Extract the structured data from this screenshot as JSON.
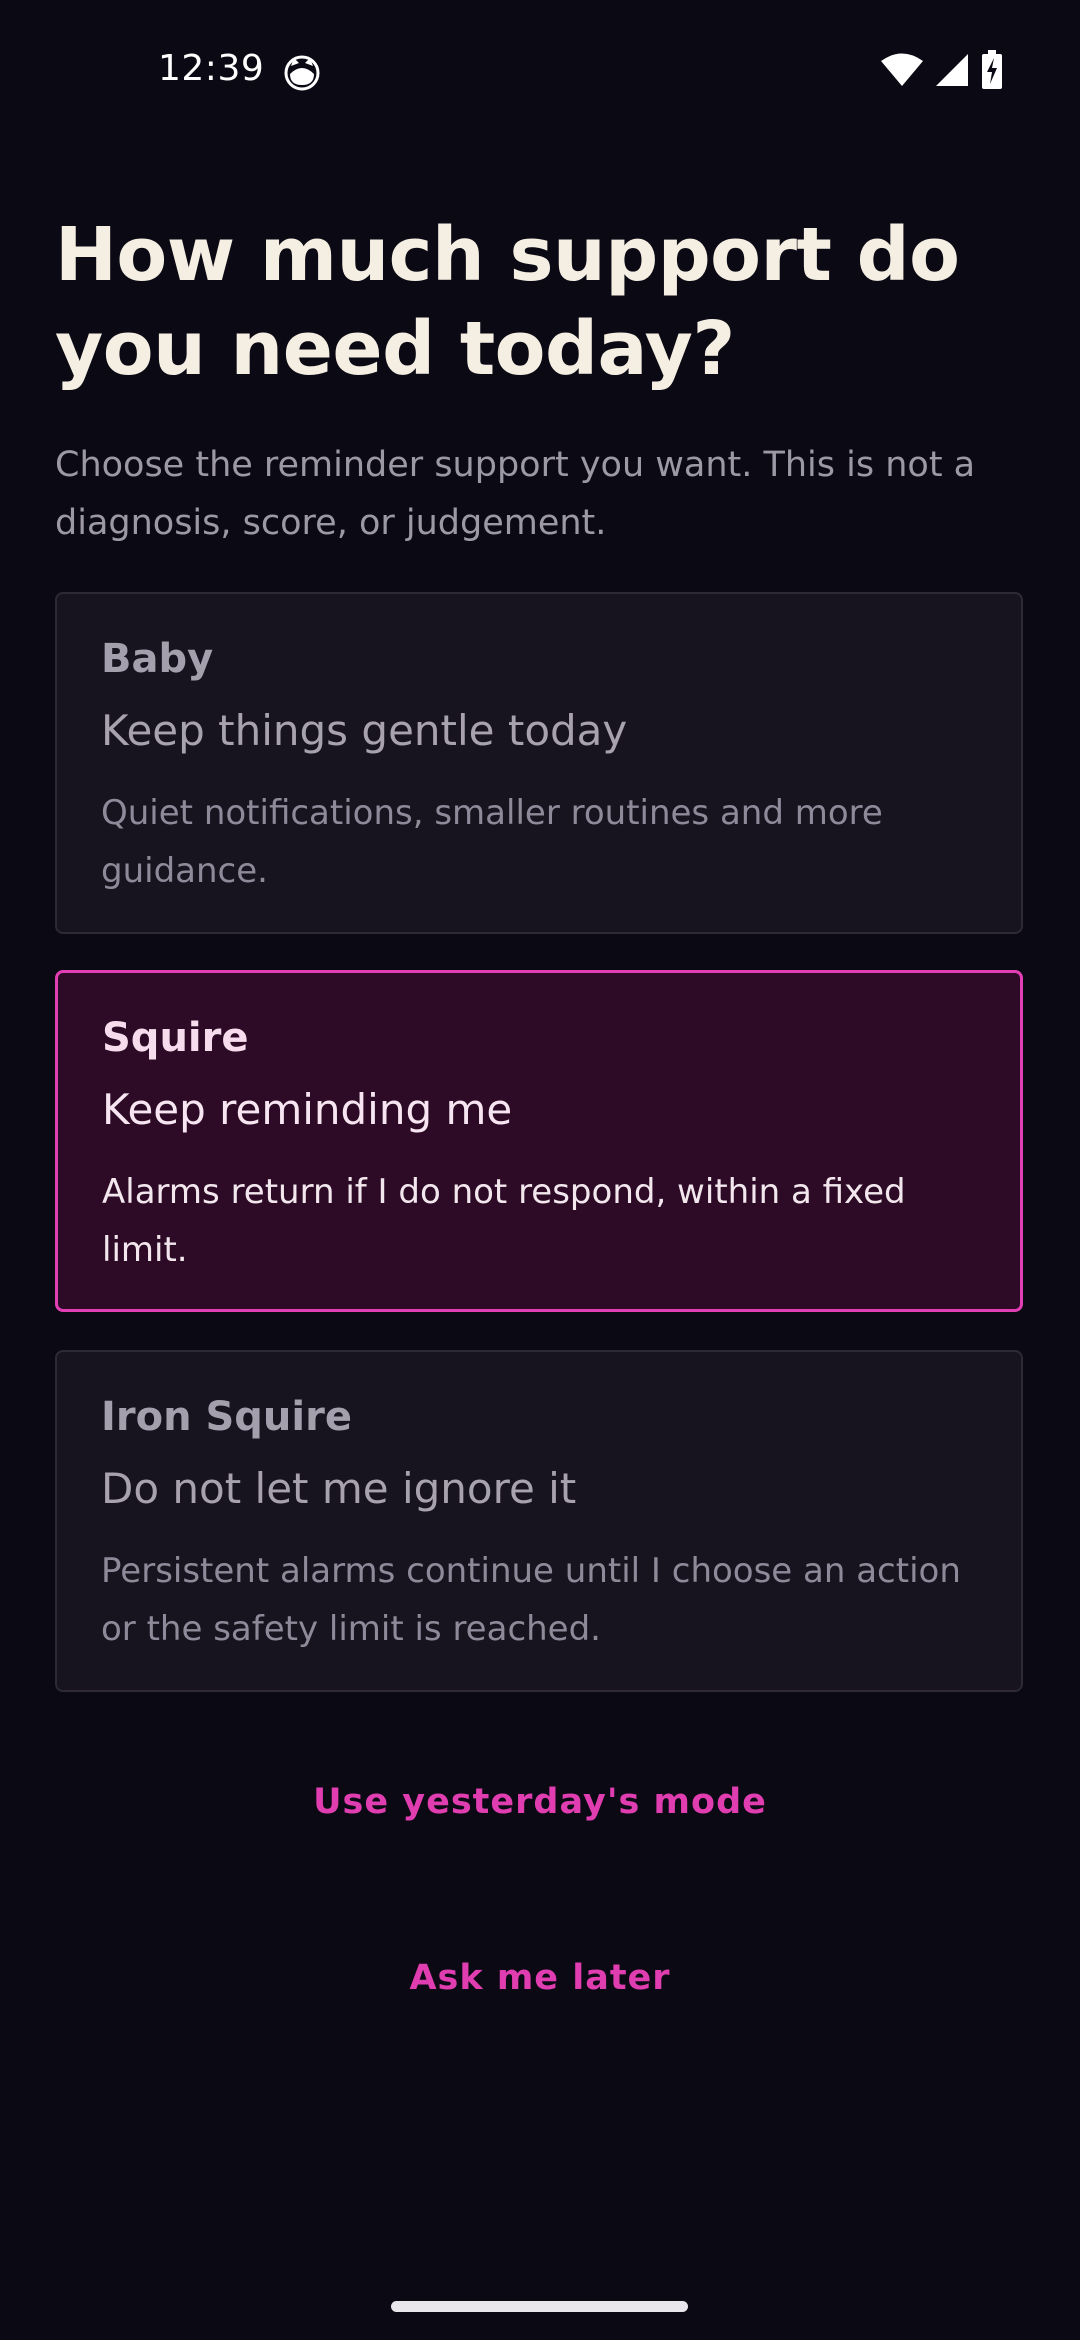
{
  "status_bar": {
    "time": "12:39",
    "app_icon": "cat-face-icon",
    "wifi_icon": "wifi-icon",
    "signal_icon": "cell-signal-icon",
    "battery_icon": "battery-charging-icon"
  },
  "header": {
    "title": "How much support do you need today?",
    "subtitle": "Choose the reminder support you want. This is not a diagnosis, score, or judgement."
  },
  "options": [
    {
      "name": "Baby",
      "tagline": "Keep things gentle today",
      "description": "Quiet notifications, smaller routines and more guidance.",
      "selected": false
    },
    {
      "name": "Squire",
      "tagline": "Keep reminding me",
      "description": "Alarms return if I do not respond, within a fixed limit.",
      "selected": true
    },
    {
      "name": "Iron Squire",
      "tagline": "Do not let me ignore it",
      "description": "Persistent alarms continue until I choose an action or the safety limit is reached.",
      "selected": false
    }
  ],
  "actions": {
    "use_yesterday_label": "Use yesterday's mode",
    "ask_later_label": "Ask me later"
  },
  "colors": {
    "background": "#0b0913",
    "accent": "#e03db0",
    "card": "#17131f",
    "card_selected": "#2d0b26"
  }
}
